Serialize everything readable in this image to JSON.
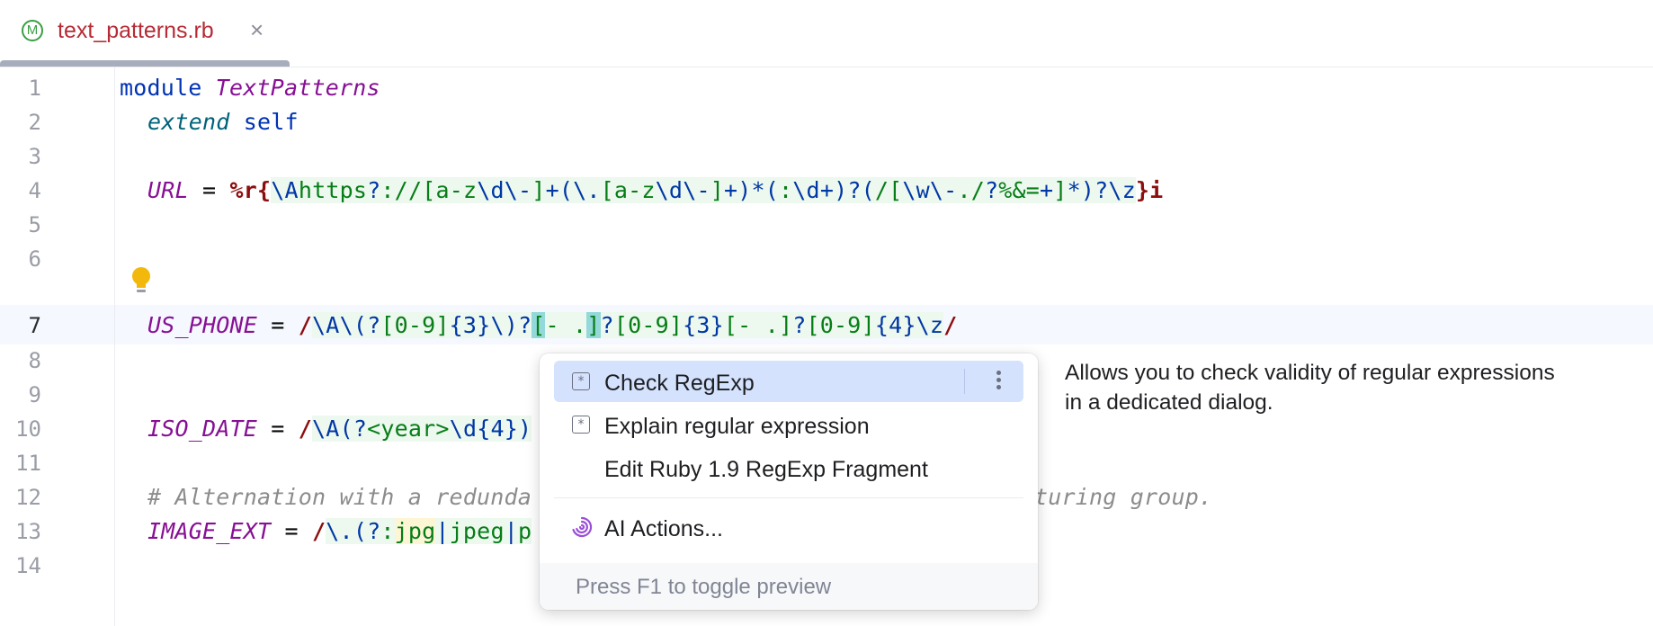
{
  "tab": {
    "icon_letter": "M",
    "title": "text_patterns.rb",
    "close_glyph": "×"
  },
  "editor": {
    "line_numbers": [
      "1",
      "2",
      "3",
      "4",
      "5",
      "6",
      "7",
      "8",
      "9",
      "10",
      "11",
      "12",
      "13",
      "14"
    ],
    "current_line": 7,
    "lines": {
      "l1": {
        "kw": "module",
        "name": "TextPatterns"
      },
      "l2": {
        "extend": "extend",
        "self": "self"
      },
      "l4": "URL = %r{\\Ahttps?://[a-z\\d\\-]+(\\.[a-z\\d\\-]+)*(:\\d+)?(/[\\w\\-./?%&=+]*)?\\z}i",
      "l7": "US_PHONE = /\\A\\(?[0-9]{3}\\)?[- .]?[0-9]{3}[- .]?[0-9]{4}\\z/",
      "l10": "ISO_DATE = /\\A(?<year>\\d{4})",
      "l12a": "# Alternation with a redunda",
      "l12b": "turing group.",
      "l13": "IMAGE_EXT = /\\.(?:jpg|jpeg|p"
    }
  },
  "popup": {
    "items": [
      {
        "label": "Check RegExp",
        "icon": "regexp-icon",
        "selected": true
      },
      {
        "label": "Explain regular expression",
        "icon": "regexp-icon"
      },
      {
        "label": "Edit Ruby 1.9 RegExp Fragment"
      },
      {
        "label": "AI Actions...",
        "icon": "ai-spiral-icon"
      }
    ],
    "footer": "Press F1 to toggle preview"
  },
  "doc_preview": {
    "line1": "Allows you to check validity of regular expressions",
    "line2": "in a dedicated dialog."
  },
  "colors": {
    "accent": "#d4e2fd",
    "keyword": "#0033b3",
    "constant": "#871094",
    "regex": "#067d17",
    "regex_escape": "#0037a6",
    "tab_title": "#b62b35"
  }
}
